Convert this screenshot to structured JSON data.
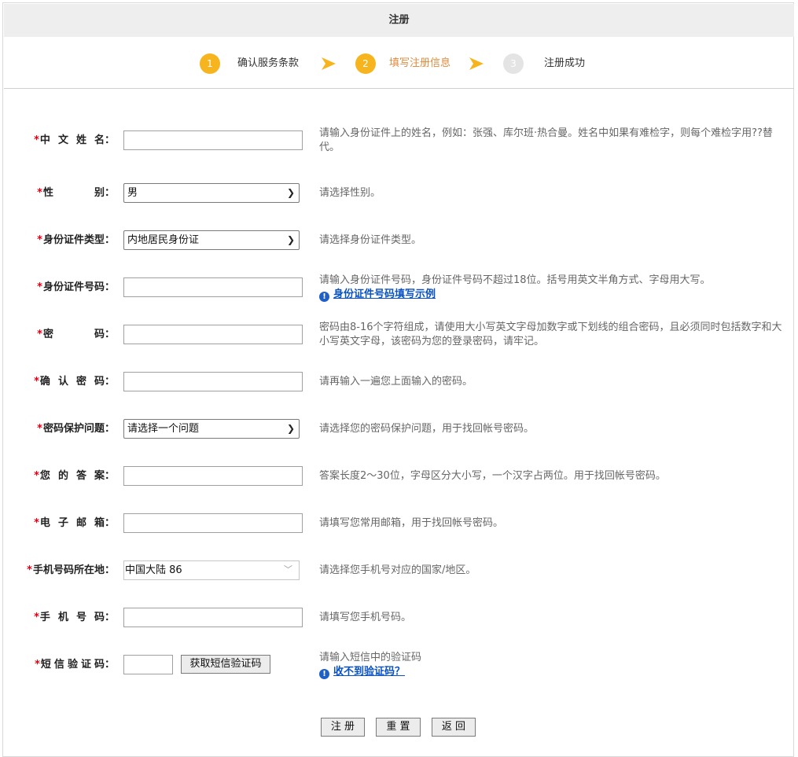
{
  "header": {
    "title": "注册"
  },
  "steps": [
    {
      "number": "1",
      "label": "确认服务条款",
      "state": "done"
    },
    {
      "number": "2",
      "label": "填写注册信息",
      "state": "current"
    },
    {
      "number": "3",
      "label": "注册成功",
      "state": "pending"
    }
  ],
  "colors": {
    "accent": "#f6b51e",
    "step_current_label": "#e08a3c",
    "required": "#e60012",
    "link": "#0a52c4",
    "pending": "#e4e4e4"
  },
  "form": {
    "required_mark": "*",
    "name": {
      "label": [
        "中",
        "文",
        "姓",
        "名"
      ],
      "value": "",
      "hint": "请输入身份证件上的姓名，例如：张强、库尔班·热合曼。姓名中如果有难检字，则每个难检字用??替代。"
    },
    "gender": {
      "label": [
        "性",
        "别"
      ],
      "selected": "男",
      "hint": "请选择性别。"
    },
    "id_type": {
      "label": "身份证件类型",
      "selected": "内地居民身份证",
      "hint": "请选择身份证件类型。"
    },
    "id_number": {
      "label": "身份证件号码",
      "value": "",
      "hint": "请输入身份证件号码，身份证件号码不超过18位。括号用英文半角方式、字母用大写。",
      "link": "身份证件号码填写示例"
    },
    "password": {
      "label": [
        "密",
        "码"
      ],
      "value": "",
      "hint": "密码由8-16个字符组成，请使用大小写英文字母加数字或下划线的组合密码，且必须同时包括数字和大小写英文字母，该密码为您的登录密码，请牢记。"
    },
    "confirm_password": {
      "label": [
        "确",
        "认",
        "密",
        "码"
      ],
      "value": "",
      "hint": "请再输入一遍您上面输入的密码。"
    },
    "security_question": {
      "label": "密码保护问题",
      "selected": "请选择一个问题",
      "hint": "请选择您的密码保护问题，用于找回帐号密码。"
    },
    "answer": {
      "label": [
        "您",
        "的",
        "答",
        "案"
      ],
      "value": "",
      "hint": "答案长度2～30位，字母区分大小写，一个汉字占两位。用于找回帐号密码。"
    },
    "email": {
      "label": [
        "电",
        "子",
        "邮",
        "箱"
      ],
      "value": "",
      "hint": "请填写您常用邮箱，用于找回帐号密码。"
    },
    "phone_region": {
      "label": "手机号码所在地",
      "selected": "中国大陆 86",
      "hint": "请选择您手机号对应的国家/地区。"
    },
    "phone": {
      "label": [
        "手",
        "机",
        "号",
        "码"
      ],
      "value": "",
      "hint": "请填写您手机号码。"
    },
    "sms_code": {
      "label": [
        "短",
        "信",
        "验",
        "证",
        "码"
      ],
      "value": "",
      "get_code_button": "获取短信验证码",
      "hint": "请输入短信中的验证码",
      "link": "收不到验证码？"
    },
    "colon": "："
  },
  "actions": {
    "submit": "注 册",
    "reset": "重 置",
    "back": "返 回"
  }
}
